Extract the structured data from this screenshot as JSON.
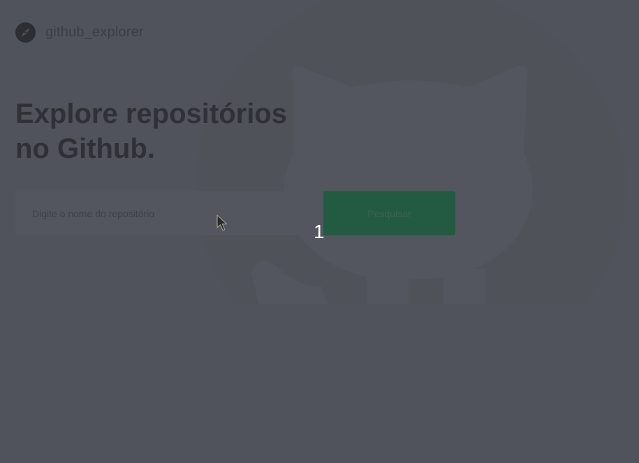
{
  "header": {
    "logo_icon": "compass-icon",
    "app_name": "github_explorer"
  },
  "hero": {
    "title_line1": "Explore repositórios",
    "title_line2": "no Github."
  },
  "search": {
    "placeholder": "Digite o nome do repositório",
    "value": "",
    "button_label": "Pesquisar"
  },
  "overlay": {
    "step_number": "1",
    "cursor_icon": "mouse-pointer-icon"
  },
  "colors": {
    "background": "#50535b",
    "button": "#235a42",
    "title": "#2f3137"
  },
  "decorations": {
    "background_icon": "github-octocat-icon"
  }
}
